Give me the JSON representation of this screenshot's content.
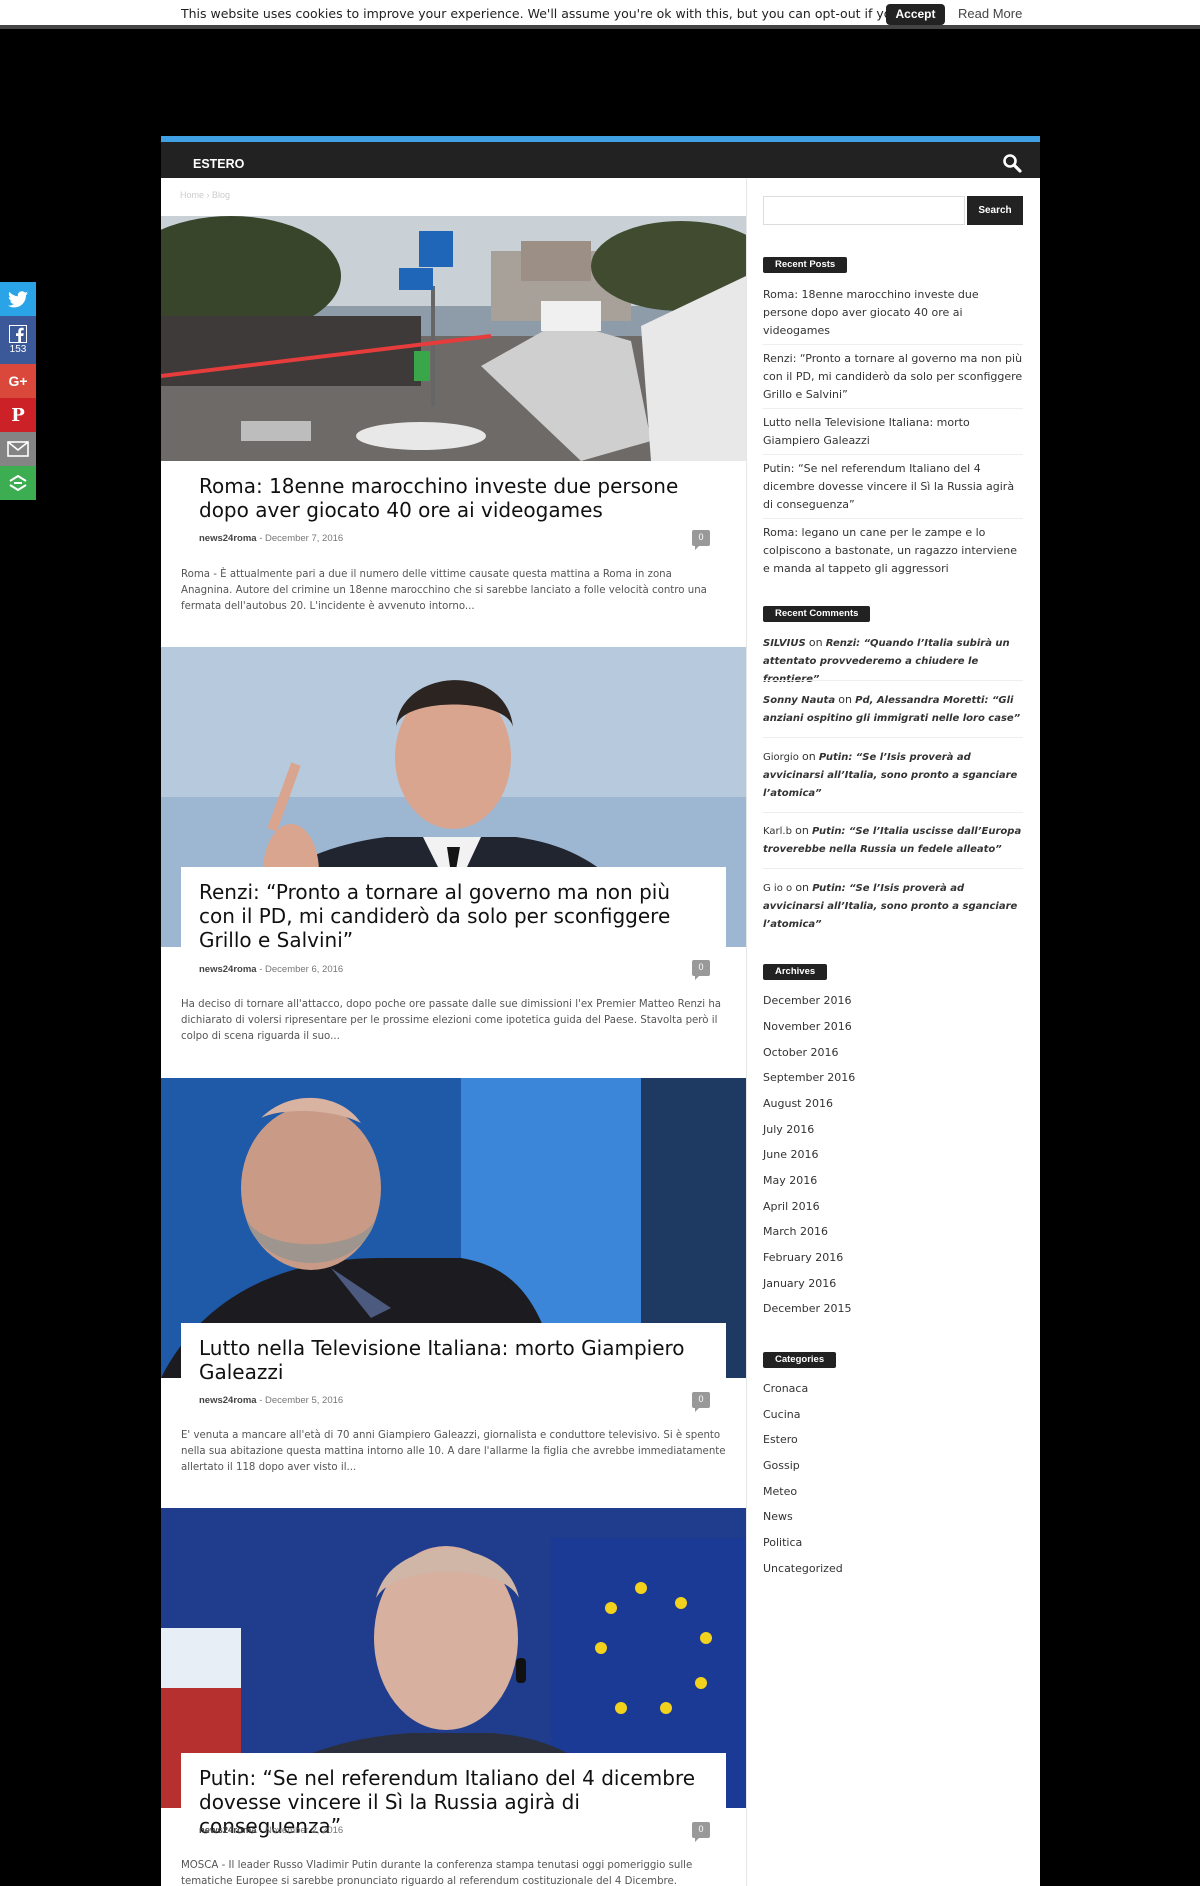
{
  "cookie": {
    "message": "This website uses cookies to improve your experience. We'll assume you're ok with this, but you can opt-out if you wish.",
    "accept_label": "Accept",
    "read_more_label": "Read More"
  },
  "social": {
    "facebook_count": "153",
    "google_plus_label": "G+",
    "pinterest_label": "P"
  },
  "nav": {
    "item": "ESTERO"
  },
  "breadcrumb": {
    "home": "Home",
    "sep": "›",
    "current": "Blog"
  },
  "posts": [
    {
      "title": "Roma: 18enne marocchino investe due persone dopo aver giocato 40 ore ai videogames",
      "author": "news24roma",
      "sep": "-",
      "date": "December 7, 2016",
      "comments": "0",
      "excerpt": "Roma - È attualmente pari a due il numero delle vittime causate questa mattina a Roma in zona Anagnina. Autore del crimine un 18enne marocchino che si sarebbe lanciato a folle velocità contro una fermata dell'autobus 20. L'incidente è avvenuto intorno..."
    },
    {
      "title": "Renzi: “Pronto a tornare al governo ma non più con il PD, mi candiderò da solo per sconfiggere Grillo e Salvini”",
      "author": "news24roma",
      "sep": "-",
      "date": "December 6, 2016",
      "comments": "0",
      "excerpt": "Ha deciso di tornare all'attacco, dopo poche ore passate dalle sue dimissioni l'ex Premier Matteo Renzi ha dichiarato di volersi ripresentare per le prossime elezioni come ipotetica guida del Paese. Stavolta però il colpo di scena riguarda il suo..."
    },
    {
      "title": "Lutto nella Televisione Italiana: morto Giampiero Galeazzi",
      "author": "news24roma",
      "sep": "-",
      "date": "December 5, 2016",
      "comments": "0",
      "excerpt": "E' venuta a mancare all'età di 70 anni Giampiero Galeazzi, giornalista e conduttore televisivo. Si è spento nella sua abitazione questa mattina intorno alle 10. A dare l'allarme la figlia che avrebbe immediatamente allertato il 118 dopo aver visto il..."
    },
    {
      "title": "Putin: “Se nel referendum Italiano del 4 dicembre dovesse vincere il Sì la Russia agirà di conseguenza”",
      "author": "news24roma",
      "sep": "-",
      "date": "November 2, 2016",
      "comments": "0",
      "excerpt": "MOSCA - Il leader Russo Vladimir Putin durante la conferenza stampa tenutasi oggi pomeriggio sulle tematiche Europee si sarebbe pronunciato riguardo al referendum costituzionale del 4 Dicembre."
    }
  ],
  "sidebar": {
    "search_button": "Search",
    "recent_posts_title": "Recent Posts",
    "recent_posts": [
      "Roma: 18enne marocchino investe due persone dopo aver giocato 40 ore ai videogames",
      "Renzi: “Pronto a tornare al governo ma non più con il PD, mi candiderò da solo per sconfiggere Grillo e Salvini”",
      "Lutto nella Televisione Italiana: morto Giampiero Galeazzi",
      "Putin: “Se nel referendum Italiano del 4 dicembre dovesse vincere il Sì la Russia agirà di conseguenza”",
      "Roma: legano un cane per le zampe e lo colpiscono a bastonate, un ragazzo interviene e manda al tappeto gli aggressori"
    ],
    "recent_comments_title": "Recent Comments",
    "on_word": "on",
    "recent_comments": [
      {
        "author": "SILVIUS",
        "post": "Renzi: “Quando l’Italia subirà un attentato provvederemo a chiudere le frontiere”"
      },
      {
        "author": "Sonny Nauta",
        "post": "Pd, Alessandra Moretti: “Gli anziani ospitino gli immigrati nelle loro case”"
      },
      {
        "author": "Giorgio",
        "post": "Putin: “Se l’Isis proverà ad avvicinarsi all’Italia, sono pronto a sganciare l’atomica”"
      },
      {
        "author": "Karl.b",
        "post": "Putin: “Se l’Italia uscisse dall’Europa troverebbe nella Russia un fedele alleato”"
      },
      {
        "author": "G io o",
        "post": "Putin: “Se l’Isis proverà ad avvicinarsi all’Italia, sono pronto a sganciare l’atomica”"
      }
    ],
    "archives_title": "Archives",
    "archives": [
      "December 2016",
      "November 2016",
      "October 2016",
      "September 2016",
      "August 2016",
      "July 2016",
      "June 2016",
      "May 2016",
      "April 2016",
      "March 2016",
      "February 2016",
      "January 2016",
      "December 2015"
    ],
    "categories_title": "Categories",
    "categories": [
      "Cronaca",
      "Cucina",
      "Estero",
      "Gossip",
      "Meteo",
      "News",
      "Politica",
      "Uncategorized"
    ]
  }
}
